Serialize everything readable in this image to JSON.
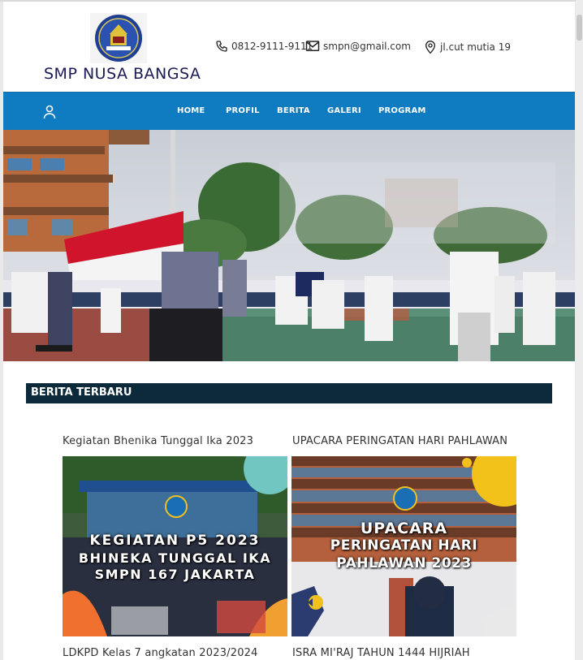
{
  "header": {
    "school_name": "SMP NUSA BANGSA",
    "phone": "0812-9111-9111",
    "email": "smpn@gmail.com",
    "address": "jl.cut mutia 19"
  },
  "nav": {
    "items": [
      "HOME",
      "PROFIL",
      "BERITA",
      "GALERI",
      "PROGRAM"
    ]
  },
  "section": {
    "title": "BERITA TERBARU"
  },
  "news": [
    {
      "title": "Kegiatan Bhenika Tunggal Ika 2023",
      "image_lines": [
        "KEGIATAN P5 2023",
        "BHINEKA TUNGGAL IKA",
        "SMPN 167 JAKARTA"
      ]
    },
    {
      "title": "UPACARA PERINGATAN HARI PAHLAWAN",
      "image_lines": [
        "UPACARA",
        "PERINGATAN HARI",
        "PAHLAWAN 2023"
      ]
    },
    {
      "title": "LDKPD Kelas 7 angkatan 2023/2024"
    },
    {
      "title": "ISRA MI'RAJ TAHUN 1444 HIJRIAH"
    }
  ],
  "colors": {
    "nav": "#0f7bc0",
    "section_bar": "#0d2a3a",
    "brand_text": "#1b1b55"
  }
}
